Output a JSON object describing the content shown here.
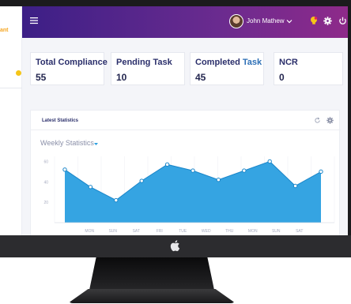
{
  "sidebar": {
    "brand_fragment": "ant"
  },
  "topbar": {
    "user_name": "John Mathew",
    "colors": {
      "start": "#3c1f86",
      "end": "#8e2a8a"
    }
  },
  "stats": [
    {
      "label": "Total Compliance",
      "value": "55"
    },
    {
      "label": "Pending Task",
      "value": "10"
    },
    {
      "label_main": "Completed",
      "label_accent": "Task",
      "value": "45"
    },
    {
      "label": "NCR",
      "value": "0"
    }
  ],
  "panel": {
    "title": "Latest Statistics",
    "chart_title": "Weekly Statistics"
  },
  "chart_data": {
    "type": "area",
    "title": "Weekly Statistics",
    "xlabel": "",
    "ylabel": "",
    "ylim": [
      0,
      65
    ],
    "y_ticks": [
      "60",
      "40",
      "20"
    ],
    "categories": [
      "",
      "MON",
      "SUN",
      "SAT",
      "FRI",
      "TUE",
      "WED",
      "THU",
      "MON",
      "SUN",
      "SAT",
      ""
    ],
    "values": [
      52,
      35,
      22,
      41,
      57,
      51,
      42,
      51,
      60,
      36,
      50
    ],
    "color": "#2a9fe0",
    "grid": true
  }
}
